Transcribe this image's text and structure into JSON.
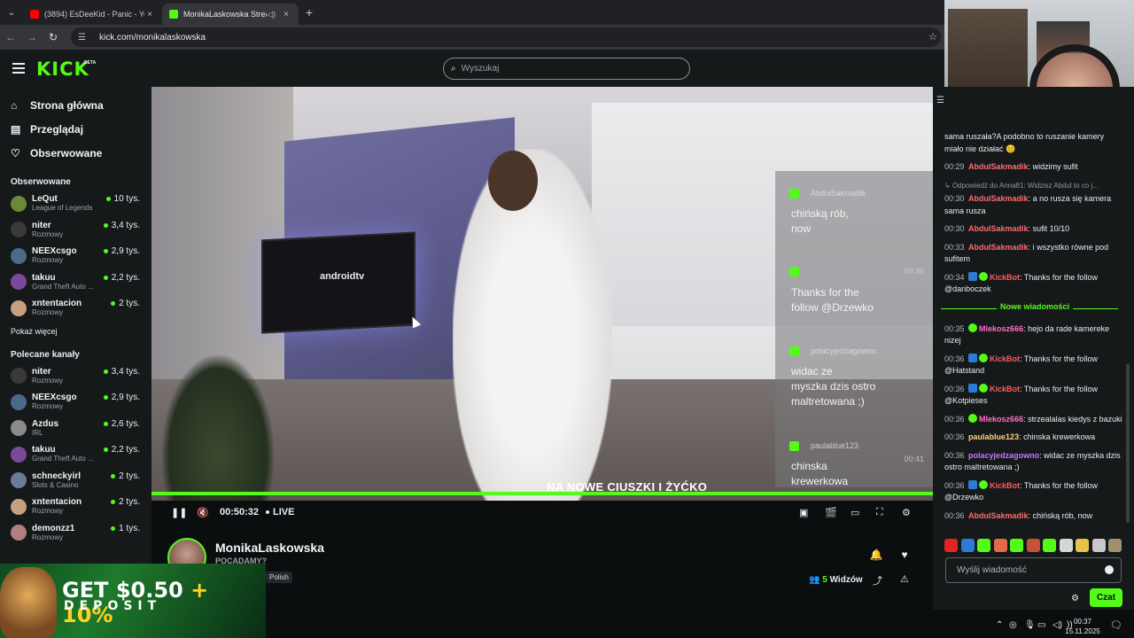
{
  "browser": {
    "tabs": [
      {
        "title": "(3894) EsDeeKid - Panic - YouTu",
        "active": false,
        "favicon_color": "#ff0000"
      },
      {
        "title": "MonikaLaskowska Stream",
        "active": true,
        "favicon_color": "#53fc18"
      }
    ],
    "url": "kick.com/monikalaskowska",
    "new_tab_label": "+",
    "close_label": "×"
  },
  "header": {
    "logo_text": "KICK",
    "logo_badge": "BETA",
    "search_placeholder": "Wyszukaj"
  },
  "sidebar": {
    "nav": [
      {
        "label": "Strona główna",
        "icon": "home-icon"
      },
      {
        "label": "Przeglądaj",
        "icon": "browse-icon"
      },
      {
        "label": "Obserwowane",
        "icon": "heart-icon"
      }
    ],
    "followed_title": "Obserwowane",
    "followed": [
      {
        "name": "LeQut",
        "category": "League of Legends",
        "viewers": "10 tys.",
        "color": "#6a8a3a"
      },
      {
        "name": "niter",
        "category": "Rozmowy",
        "viewers": "3,4 tys.",
        "color": "#3a3a3a"
      },
      {
        "name": "NEEXcsgo",
        "category": "Rozmowy",
        "viewers": "2,9 tys.",
        "color": "#4a6a8a"
      },
      {
        "name": "takuu",
        "category": "Grand Theft Auto ...",
        "viewers": "2,2 tys.",
        "color": "#7a4a9a"
      },
      {
        "name": "xntentacion",
        "category": "Rozmowy",
        "viewers": "2 tys.",
        "color": "#c8a080"
      }
    ],
    "show_more": "Pokaż więcej",
    "recommended_title": "Polecane kanały",
    "recommended": [
      {
        "name": "niter",
        "category": "Rozmowy",
        "viewers": "3,4 tys.",
        "color": "#3a3a3a"
      },
      {
        "name": "NEEXcsgo",
        "category": "Rozmowy",
        "viewers": "2,9 tys.",
        "color": "#4a6a8a"
      },
      {
        "name": "Azdus",
        "category": "IRL",
        "viewers": "2,6 tys.",
        "color": "#8a8a8a"
      },
      {
        "name": "takuu",
        "category": "Grand Theft Auto ...",
        "viewers": "2,2 tys.",
        "color": "#7a4a9a"
      },
      {
        "name": "schneckyirl",
        "category": "Slots & Casino",
        "viewers": "2 tys.",
        "color": "#6a7a9a"
      },
      {
        "name": "xntentacion",
        "category": "Rozmowy",
        "viewers": "2 tys.",
        "color": "#c8a080"
      },
      {
        "name": "demonzz1",
        "category": "Rozmowy",
        "viewers": "1 tys.",
        "color": "#b08080"
      }
    ]
  },
  "video": {
    "tv_logo": "androidtv",
    "caption": "NA NOWE CIUSZKI I ŻYĆKO",
    "overlay_messages": [
      {
        "user": "AbdulSakmadik",
        "time": "",
        "text": [
          "chińską rób,",
          "now"
        ]
      },
      {
        "user": "",
        "time": "00:35",
        "text": [
          "Thanks for the",
          "follow @Drzewko"
        ]
      },
      {
        "user": "polacyjedzagowno",
        "time": "",
        "text": [
          "widac ze",
          "myszka dzis ostro",
          "maltretowana ;)"
        ]
      },
      {
        "user": "paulablue123",
        "time": "00:41",
        "text": [
          "chinska",
          "krewerkowa"
        ]
      }
    ]
  },
  "controls": {
    "time": "00:50:32",
    "live_label": "LIVE"
  },
  "channel": {
    "name": "MonikaLaskowska",
    "subtitle": "POCADAMY?",
    "tag": "Polish",
    "viewers_count": "5",
    "viewers_label": "Widzów"
  },
  "ad": {
    "line1_amount": "GET $0.50",
    "line1_bonus": "+ 10%",
    "line2": "DEPOSIT"
  },
  "chat": {
    "messages": [
      {
        "time": "",
        "user": "",
        "user_color": "#e9edf0",
        "badges": [],
        "text": "sama ruszała?A podobno to ruszanie kamery miało nie działać 😊"
      },
      {
        "time": "00:29",
        "user": "AbdulSakmadik",
        "user_color": "#ff6b6b",
        "badges": [],
        "text": "widzimy sufit"
      },
      {
        "reply": "Odpowiedź do Anna81: Widzisz Abdul to co j..."
      },
      {
        "time": "00:30",
        "user": "AbdulSakmadik",
        "user_color": "#ff6b6b",
        "badges": [],
        "text": "a no rusza się kamera sama rusza"
      },
      {
        "time": "00:30",
        "user": "AbdulSakmadik",
        "user_color": "#ff6b6b",
        "badges": [],
        "text": "sufit 10/10"
      },
      {
        "time": "00:33",
        "user": "AbdulSakmadik",
        "user_color": "#ff6b6b",
        "badges": [],
        "text": "i wszystko równe pod sufitem"
      },
      {
        "time": "00:34",
        "user": "KickBot",
        "user_color": "#ff5a5a",
        "badges": [
          "bot",
          "ver"
        ],
        "text": "Thanks for the follow @danboczek"
      },
      {
        "divider": "Nowe wiadomości"
      },
      {
        "time": "00:35",
        "user": "Mlekosz666",
        "user_color": "#ff6ec7",
        "badges": [
          "ver"
        ],
        "text": "hejo da rade kamereke nizej"
      },
      {
        "time": "00:36",
        "user": "KickBot",
        "user_color": "#ff5a5a",
        "badges": [
          "bot",
          "ver"
        ],
        "text": "Thanks for the follow @Hatstand"
      },
      {
        "time": "00:36",
        "user": "KickBot",
        "user_color": "#ff5a5a",
        "badges": [
          "bot",
          "ver"
        ],
        "text": "Thanks for the follow @Kotpieses"
      },
      {
        "time": "00:36",
        "user": "Mlekosz666",
        "user_color": "#ff6ec7",
        "badges": [
          "ver"
        ],
        "text": "strzealalas kiedys z bazuki"
      },
      {
        "time": "00:36",
        "user": "paulablue123",
        "user_color": "#ffd27a",
        "badges": [],
        "text": "chinska krewerkowa"
      },
      {
        "time": "00:36",
        "user": "polacyjedzagowno",
        "user_color": "#c07aff",
        "badges": [],
        "text": "widac ze myszka dzis ostro maltretowana ;)"
      },
      {
        "time": "00:36",
        "user": "KickBot",
        "user_color": "#ff5a5a",
        "badges": [
          "bot",
          "ver"
        ],
        "text": "Thanks for the follow @Drzewko"
      },
      {
        "time": "00:36",
        "user": "AbdulSakmadik",
        "user_color": "#ff6b6b",
        "badges": [],
        "text": "chińską rób, now"
      }
    ],
    "emote_colors": [
      "#e02424",
      "#2c7bd6",
      "#53fc18",
      "#e26a4a",
      "#53fc18",
      "#c4523a",
      "#53fc18",
      "#d6d6d6",
      "#e8c24a",
      "#c8c8c8",
      "#a09070"
    ],
    "input_placeholder": "Wyślij wiadomość",
    "send_label": "Czat"
  },
  "taskbar": {
    "time": "00:37",
    "date": "15.11.2025",
    "notif_count": "3"
  }
}
